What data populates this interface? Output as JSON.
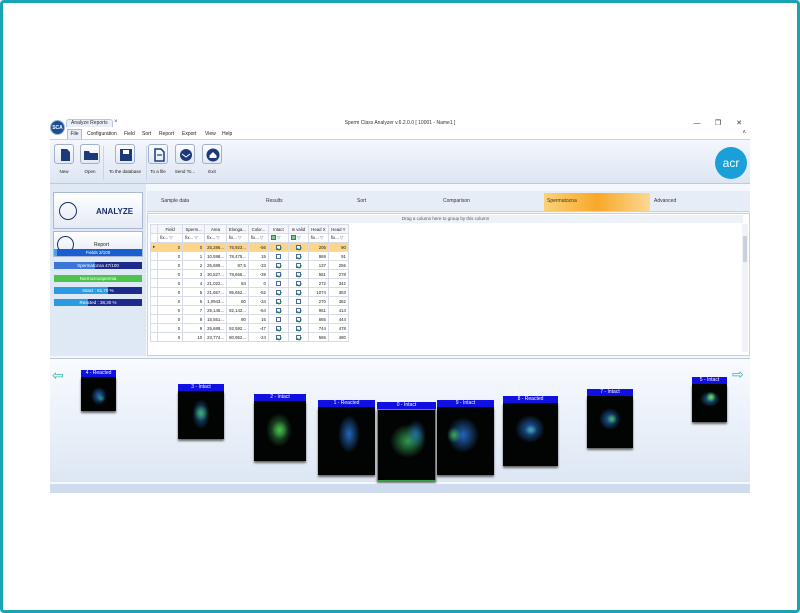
{
  "window": {
    "doc_tab": "Analyze Reports",
    "doc_tab_close": "×",
    "title": "Sperm Class Analyzer v.6.2.0.0 [ 10001 - Name1 ]",
    "logo": "SCA",
    "controls": {
      "minimize": "—",
      "restore": "❐",
      "close": "✕"
    }
  },
  "menu": {
    "items": [
      "File",
      "Configuration",
      "Field",
      "Sort",
      "Report",
      "Export",
      "View",
      "Help"
    ],
    "collapse": "˄"
  },
  "ribbon": {
    "buttons": [
      {
        "label": "New",
        "icon": "new-document-icon"
      },
      {
        "label": "Open",
        "icon": "open-folder-icon"
      },
      {
        "label": "To the database",
        "icon": "save-disk-icon"
      },
      {
        "label": "To a file",
        "icon": "export-file-icon"
      },
      {
        "label": "Send To...",
        "icon": "send-mail-icon"
      },
      {
        "label": "Exit",
        "icon": "home-exit-icon"
      }
    ],
    "brand": "acr"
  },
  "left_panel": {
    "analyze_label": "ANALYZE",
    "report_label": "Report",
    "status_bars": [
      {
        "text": "Fields 3/100",
        "bg": "#1a5fd0",
        "fill_color": "#4aa0e8",
        "fill": 0.03
      },
      {
        "text": "Spermatozoa 47/100",
        "bg": "#1d2a8c",
        "fill_color": "#3a76d6",
        "fill": 0.47
      },
      {
        "text": "Normozoospermia",
        "bg": "#4ec24e",
        "fill_color": "#4ec24e",
        "fill": 1.0
      },
      {
        "text": "Intact : 61,70 %",
        "bg": "#1d2a8c",
        "fill_color": "#2a9be0",
        "fill": 0.617
      },
      {
        "text": "Reacted : 38,30 %",
        "bg": "#1d2a8c",
        "fill_color": "#2a9be0",
        "fill": 0.383
      }
    ]
  },
  "tabs": {
    "items": [
      "Sample data",
      "Results",
      "Sort",
      "Comparison",
      "Spermatozoa",
      "Advanced"
    ],
    "active": "Spermatozoa"
  },
  "grid": {
    "group_hint": "Drag a column here to group by this column",
    "columns": [
      "Field",
      "Sperm...",
      "Area",
      "Elonga...",
      "Color...",
      "Intact",
      "Is valid",
      "Head X",
      "Head Y"
    ],
    "filter_text": "fix...",
    "rows": [
      {
        "field": "0",
        "sperm": "0",
        "area": "25,286...",
        "elong": "76,923...",
        "color": "-56",
        "intact": true,
        "valid": true,
        "hx": "205",
        "hy": "90"
      },
      {
        "field": "0",
        "sperm": "1",
        "area": "10,598...",
        "elong": "78,475...",
        "color": "15",
        "intact": false,
        "valid": true,
        "hx": "869",
        "hy": "91"
      },
      {
        "field": "0",
        "sperm": "2",
        "area": "25,689...",
        "elong": "87,5",
        "color": "-33",
        "intact": true,
        "valid": true,
        "hx": "137",
        "hy": "255"
      },
      {
        "field": "0",
        "sperm": "3",
        "area": "30,527...",
        "elong": "78,666...",
        "color": "-39",
        "intact": true,
        "valid": true,
        "hx": "551",
        "hy": "278"
      },
      {
        "field": "0",
        "sperm": "4",
        "area": "21,022...",
        "elong": "84",
        "color": "0",
        "intact": false,
        "valid": true,
        "hx": "272",
        "hy": "342"
      },
      {
        "field": "0",
        "sperm": "5",
        "area": "21,657...",
        "elong": "95,652...",
        "color": "-52",
        "intact": true,
        "valid": true,
        "hx": "1074",
        "hy": "353"
      },
      {
        "field": "0",
        "sperm": "6",
        "area": "1,0943...",
        "elong": "80",
        "color": "-34",
        "intact": true,
        "valid": false,
        "hx": "270",
        "hy": "362"
      },
      {
        "field": "0",
        "sperm": "7",
        "area": "29,145...",
        "elong": "82,142...",
        "color": "-54",
        "intact": true,
        "valid": true,
        "hx": "951",
        "hy": "414"
      },
      {
        "field": "0",
        "sperm": "8",
        "area": "15,551...",
        "elong": "80",
        "color": "16",
        "intact": false,
        "valid": true,
        "hx": "665",
        "hy": "444"
      },
      {
        "field": "0",
        "sperm": "9",
        "area": "25,689...",
        "elong": "92,592...",
        "color": "-47",
        "intact": true,
        "valid": true,
        "hx": "744",
        "hy": "478"
      },
      {
        "field": "0",
        "sperm": "10",
        "area": "23,774...",
        "elong": "80,952...",
        "color": "-24",
        "intact": true,
        "valid": true,
        "hx": "565",
        "hy": "480"
      }
    ]
  },
  "strip": {
    "left_arrow": "⇦",
    "right_arrow": "⇨",
    "cells": [
      {
        "label": "4 - Reacted"
      },
      {
        "label": "3 - Intact"
      },
      {
        "label": "2 - Intact"
      },
      {
        "label": "1 - Reacted"
      },
      {
        "label": "0 - Intact"
      },
      {
        "label": "9 - Intact"
      },
      {
        "label": "8 - Reacted"
      },
      {
        "label": "7 - Intact"
      },
      {
        "label": "5 - Intact"
      }
    ]
  }
}
